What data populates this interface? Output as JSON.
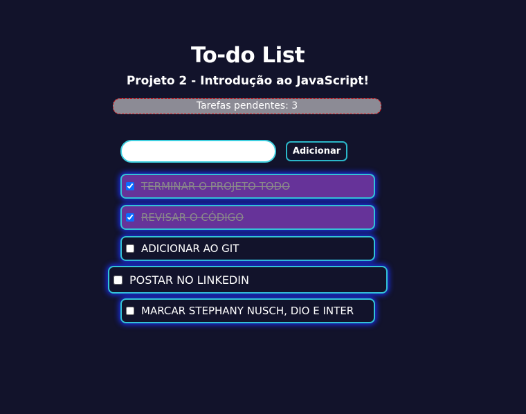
{
  "header": {
    "title": "To-do List",
    "subtitle": "Projeto 2 - Introdução ao JavaScript!"
  },
  "pending": {
    "text": "Tarefas pendentes: 3",
    "count": 3
  },
  "form": {
    "input_value": "",
    "add_label": "Adicionar"
  },
  "tasks": [
    {
      "label": "TERMINAR O PROJETO TODO",
      "done": true
    },
    {
      "label": "REVISAR O CÓDIGO",
      "done": true
    },
    {
      "label": "ADICIONAR AO GIT",
      "done": false
    },
    {
      "label": "POSTAR NO LINKEDIN",
      "done": false
    },
    {
      "label": "MARCAR STEPHANY NUSCH, DIO E INTER",
      "done": false
    }
  ],
  "colors": {
    "background": "#12132b",
    "done_bg": "#663399",
    "border": "#33c4d6",
    "glow": "#1a2fe8"
  }
}
